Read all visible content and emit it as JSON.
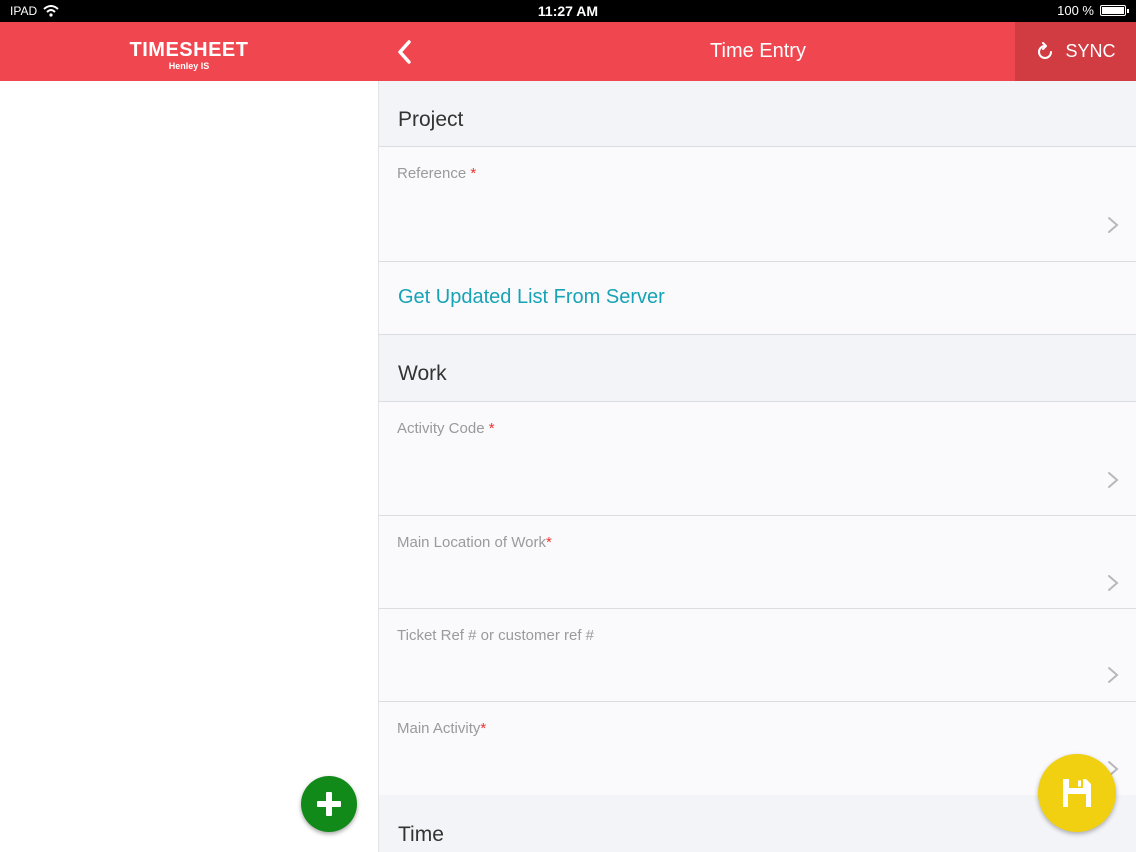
{
  "status_bar": {
    "carrier": "IPAD",
    "time": "11:27 AM",
    "battery_text": "100 %",
    "battery_level": 1.0
  },
  "nav": {
    "brand_title": "TIMESHEET",
    "brand_subtitle": "Henley IS",
    "title": "Time Entry",
    "sync_label": "SYNC",
    "back_icon": "chevron-left-icon",
    "sync_icon": "refresh-icon",
    "color": "#f0464f"
  },
  "sections": {
    "project": "Project",
    "work": "Work",
    "time": "Time"
  },
  "fields": {
    "reference": {
      "label": "Reference",
      "required_mark": "*",
      "value": ""
    },
    "activity_code": {
      "label": "Activity Code",
      "required_mark": "*",
      "value": ""
    },
    "main_location": {
      "label": "Main Location of Work",
      "required_mark": "*",
      "value": ""
    },
    "ticket_ref": {
      "label": "Ticket Ref # or customer ref #",
      "value": ""
    },
    "main_activity": {
      "label": "Main Activity",
      "required_mark": "*",
      "value": ""
    }
  },
  "get_updated_list_label": "Get Updated List From Server",
  "fabs": {
    "add_icon": "plus-icon",
    "add_color": "#128a1a",
    "save_icon": "floppy-disk-icon",
    "save_color": "#f0d010"
  },
  "link_color": "#17a3b5"
}
